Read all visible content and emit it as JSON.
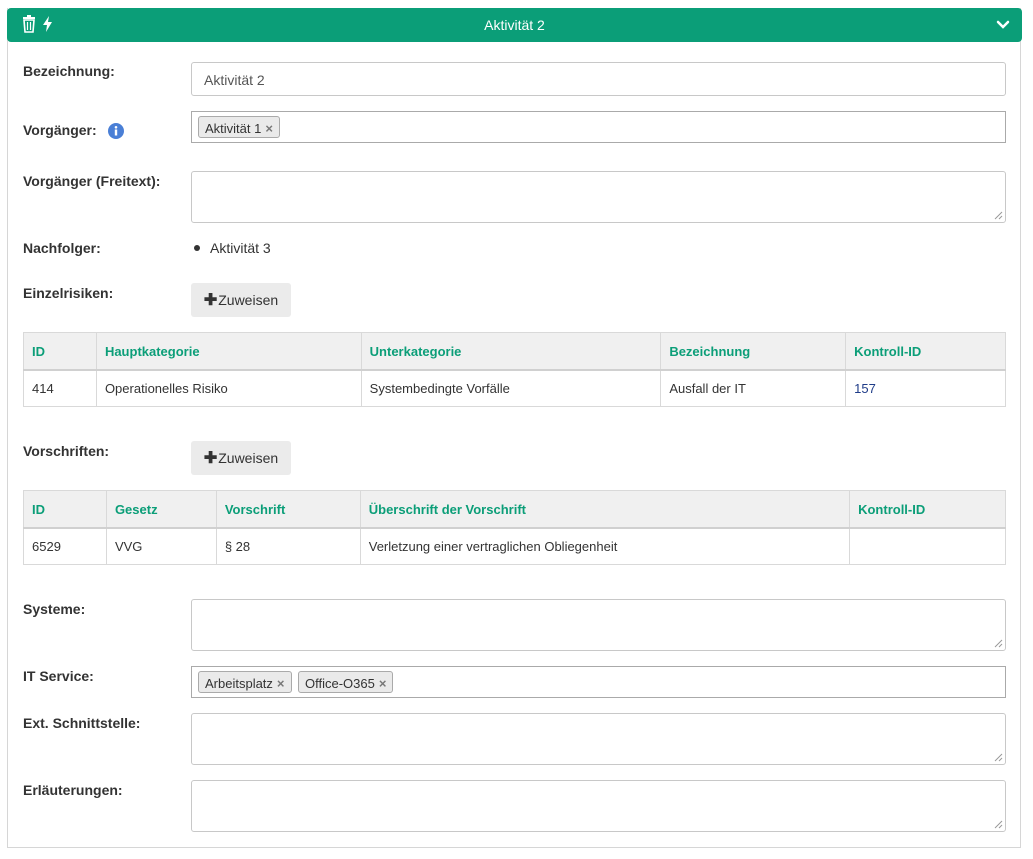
{
  "header": {
    "title": "Aktivität 2",
    "left_icons": [
      "trash-icon",
      "bolt-icon"
    ],
    "right_icon": "chevron-down-icon",
    "color": "#0b9e78"
  },
  "fields": {
    "bezeichnung": {
      "label": "Bezeichnung:",
      "value": "Aktivität 2"
    },
    "vorgaenger": {
      "label": "Vorgänger:",
      "info_icon": "info-icon",
      "tags": [
        "Aktivität 1"
      ]
    },
    "vorgaenger_freitext": {
      "label": "Vorgänger (Freitext):",
      "value": ""
    },
    "nachfolger": {
      "label": "Nachfolger:",
      "items": [
        "Aktivität 3"
      ]
    },
    "einzelrisiken": {
      "label": "Einzelrisiken:",
      "button": "Zuweisen"
    },
    "vorschriften": {
      "label": "Vorschriften:",
      "button": "Zuweisen"
    },
    "systeme": {
      "label": "Systeme:",
      "value": ""
    },
    "it_service": {
      "label": "IT Service:",
      "tags": [
        "Arbeitsplatz",
        "Office-O365"
      ]
    },
    "ext_schnittstelle": {
      "label": "Ext. Schnittstelle:",
      "value": ""
    },
    "erlaeuterungen": {
      "label": "Erläuterungen:",
      "value": ""
    }
  },
  "risks_table": {
    "headers": [
      "ID",
      "Hauptkategorie",
      "Unterkategorie",
      "Bezeichnung",
      "Kontroll-ID"
    ],
    "rows": [
      [
        "414",
        "Operationelles Risiko",
        "Systembedingte Vorfälle",
        "Ausfall der IT",
        "157"
      ]
    ]
  },
  "regulations_table": {
    "headers": [
      "ID",
      "Gesetz",
      "Vorschrift",
      "Überschrift der Vorschrift",
      "Kontroll-ID"
    ],
    "rows": [
      [
        "6529",
        "VVG",
        "§ 28",
        "Verletzung einer vertraglichen Obliegenheit",
        ""
      ]
    ]
  }
}
